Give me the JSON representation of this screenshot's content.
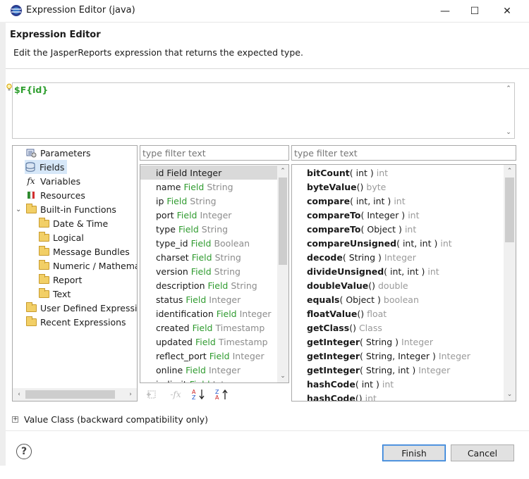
{
  "window": {
    "title": "Expression Editor (java)",
    "minimize": "—",
    "maximize": "☐",
    "close": "✕"
  },
  "header": {
    "title": "Expression Editor",
    "description": "Edit the JasperReports expression that returns the expected type."
  },
  "expression": {
    "value": "$F{id}"
  },
  "tree": {
    "items": [
      {
        "label": "Parameters",
        "icon": "parameters-icon"
      },
      {
        "label": "Fields",
        "icon": "fields-icon",
        "selected": true
      },
      {
        "label": "Variables",
        "icon": "variables-icon"
      },
      {
        "label": "Resources",
        "icon": "resources-icon"
      },
      {
        "label": "Built-in Functions",
        "icon": "folder-icon",
        "expanded": true
      },
      {
        "label": "Date & Time",
        "icon": "folder-icon"
      },
      {
        "label": "Logical",
        "icon": "folder-icon"
      },
      {
        "label": "Message Bundles",
        "icon": "folder-icon"
      },
      {
        "label": "Numeric / Mathemat",
        "icon": "folder-icon"
      },
      {
        "label": "Report",
        "icon": "folder-icon"
      },
      {
        "label": "Text",
        "icon": "folder-icon"
      },
      {
        "label": "User Defined Expressio",
        "icon": "folder-icon"
      },
      {
        "label": "Recent Expressions",
        "icon": "folder-icon"
      }
    ]
  },
  "filters": {
    "middle_placeholder": "type filter text",
    "right_placeholder": "type filter text"
  },
  "fields": {
    "keyword": "Field",
    "items": [
      {
        "name": "id",
        "type": "Integer",
        "selected": true
      },
      {
        "name": "name",
        "type": "String"
      },
      {
        "name": "ip",
        "type": "String"
      },
      {
        "name": "port",
        "type": "Integer"
      },
      {
        "name": "type",
        "type": "String"
      },
      {
        "name": "type_id",
        "type": "Boolean"
      },
      {
        "name": "charset",
        "type": "String"
      },
      {
        "name": "version",
        "type": "String"
      },
      {
        "name": "description",
        "type": "String"
      },
      {
        "name": "status",
        "type": "Integer"
      },
      {
        "name": "identification",
        "type": "Integer"
      },
      {
        "name": "created",
        "type": "Timestamp"
      },
      {
        "name": "updated",
        "type": "Timestamp"
      },
      {
        "name": "reflect_port",
        "type": "Integer"
      },
      {
        "name": "online",
        "type": "Integer"
      },
      {
        "name": "is_limit",
        "type": "Integer"
      }
    ]
  },
  "methods": {
    "items": [
      {
        "name": "bitCount",
        "args": "( int )",
        "ret": "int"
      },
      {
        "name": "byteValue",
        "args": "()",
        "ret": "byte"
      },
      {
        "name": "compare",
        "args": "( int, int )",
        "ret": "int"
      },
      {
        "name": "compareTo",
        "args": "( Integer )",
        "ret": "int"
      },
      {
        "name": "compareTo",
        "args": "( Object )",
        "ret": "int"
      },
      {
        "name": "compareUnsigned",
        "args": "( int, int )",
        "ret": "int"
      },
      {
        "name": "decode",
        "args": "( String )",
        "ret": "Integer"
      },
      {
        "name": "divideUnsigned",
        "args": "( int, int )",
        "ret": "int"
      },
      {
        "name": "doubleValue",
        "args": "()",
        "ret": "double"
      },
      {
        "name": "equals",
        "args": "( Object )",
        "ret": "boolean"
      },
      {
        "name": "floatValue",
        "args": "()",
        "ret": "float"
      },
      {
        "name": "getClass",
        "args": "()",
        "ret": "Class"
      },
      {
        "name": "getInteger",
        "args": "( String )",
        "ret": "Integer"
      },
      {
        "name": "getInteger",
        "args": "( String, Integer )",
        "ret": "Integer"
      },
      {
        "name": "getInteger",
        "args": "( String, int )",
        "ret": "Integer"
      },
      {
        "name": "hashCode",
        "args": "( int )",
        "ret": "int"
      },
      {
        "name": "hashCode",
        "args": "()",
        "ret": "int"
      }
    ]
  },
  "value_class": {
    "label": "Value Class (backward compatibility only)"
  },
  "footer": {
    "help": "?",
    "finish_label": "Finish",
    "cancel_label": "Cancel"
  }
}
